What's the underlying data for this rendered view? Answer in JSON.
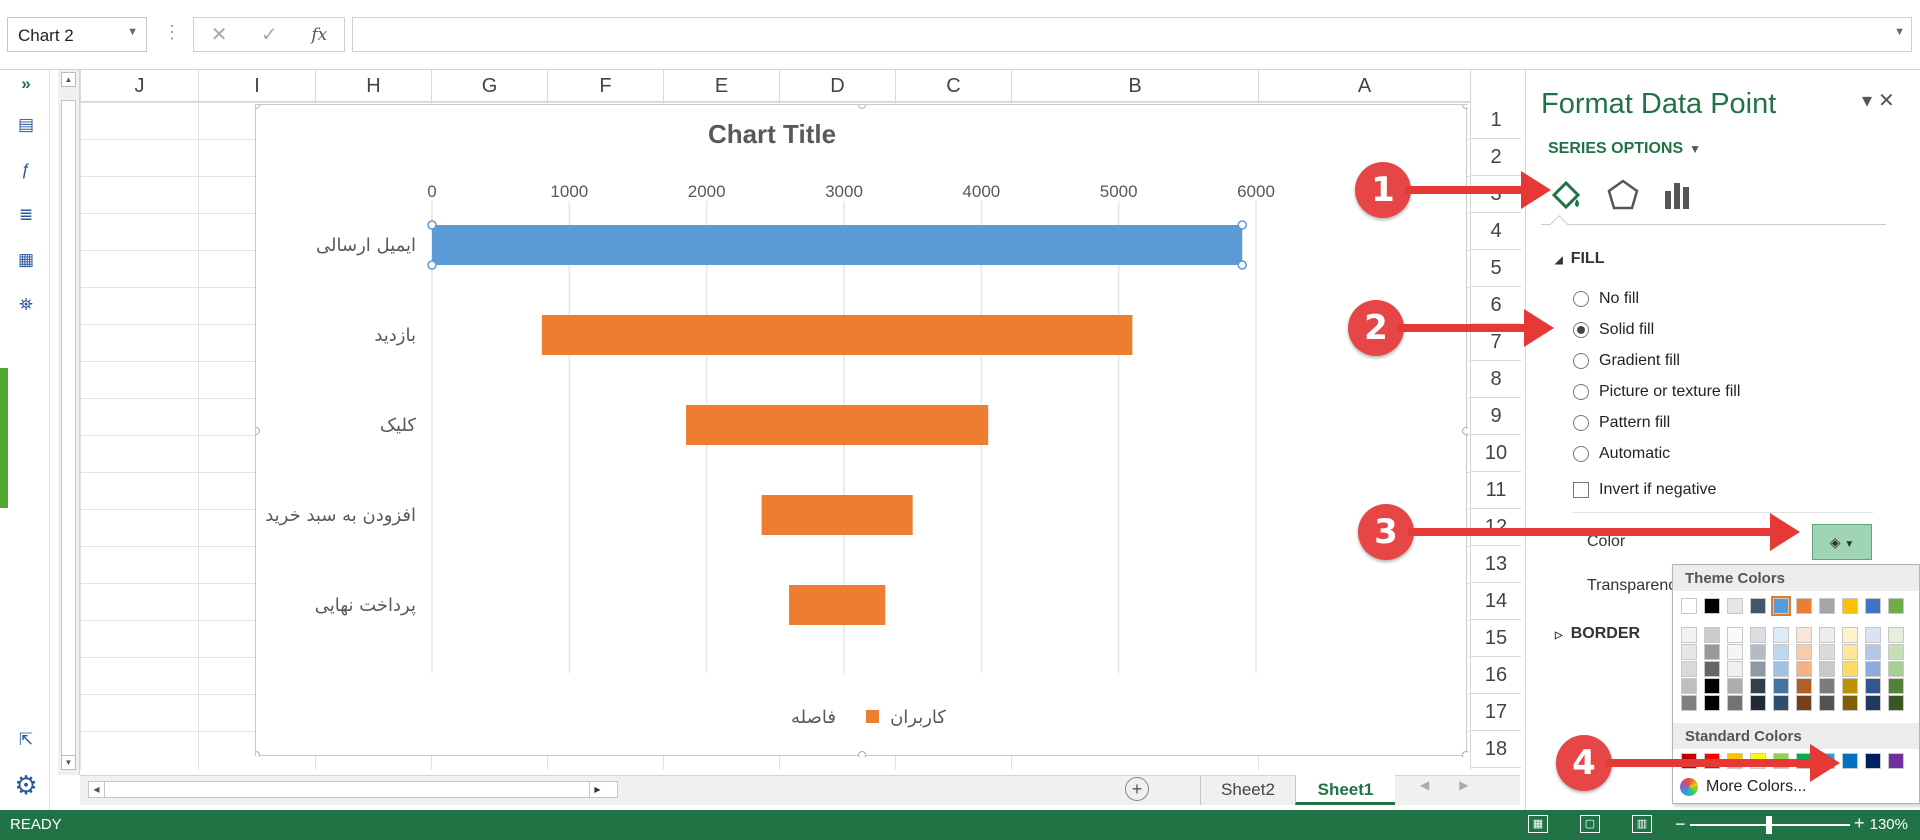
{
  "formula_bar": {
    "name_box": "Chart 2",
    "fx_label": "fx",
    "cancel": "✕",
    "enter": "✓",
    "formula_value": ""
  },
  "columns": [
    "J",
    "I",
    "H",
    "G",
    "F",
    "E",
    "D",
    "C",
    "B",
    "A"
  ],
  "rows": [
    "1",
    "2",
    "3",
    "4",
    "5",
    "6",
    "7",
    "8",
    "9",
    "10",
    "11",
    "12",
    "13",
    "14",
    "15",
    "16",
    "17",
    "18"
  ],
  "chart_data": {
    "type": "bar",
    "title": "Chart Title",
    "orientation": "horizontal-reversed",
    "xlim": [
      0,
      6000
    ],
    "ticks": [
      "0",
      "1000",
      "2000",
      "3000",
      "4000",
      "5000",
      "6000"
    ],
    "categories": [
      "ایمیل ارسالی",
      "بازدید",
      "کلیک",
      "افزودن به سبد خرید",
      "پرداخت نهایی"
    ],
    "series": [
      {
        "name": "فاصله",
        "values": [
          0,
          800,
          1850,
          2400,
          2600
        ],
        "color": "none"
      },
      {
        "name": "کاربران",
        "values": [
          5900,
          4300,
          2200,
          1100,
          700
        ],
        "color": "#ed7d31"
      }
    ],
    "selected_point_color": "#5b9bd5",
    "legend": [
      "کاربران",
      "فاصله"
    ],
    "legend_position": "bottom"
  },
  "sheets": {
    "tabs": [
      "Sheet2",
      "Sheet1"
    ],
    "active": "Sheet1",
    "add": "+"
  },
  "status": {
    "mode": "READY",
    "zoom": "130%"
  },
  "pane": {
    "title": "Format Data Point",
    "section": "SERIES OPTIONS",
    "fill_header": "FILL",
    "fill_options": [
      "No fill",
      "Solid fill",
      "Gradient fill",
      "Picture or texture fill",
      "Pattern fill",
      "Automatic"
    ],
    "selected_fill": "Solid fill",
    "invert": "Invert if negative",
    "color_label": "Color",
    "transparency_label": "Transparenc",
    "border_header": "BORDER"
  },
  "color_popup": {
    "theme_header": "Theme Colors",
    "standard_header": "Standard Colors",
    "more": "More Colors...",
    "theme_top": [
      "#ffffff",
      "#000000",
      "#e7e6e6",
      "#44546a",
      "#5b9bd5",
      "#ed7d31",
      "#a5a5a5",
      "#ffc000",
      "#4472c4",
      "#70ad47"
    ],
    "standard": [
      "#c00000",
      "#ff0000",
      "#ffc000",
      "#ffff00",
      "#92d050",
      "#00b050",
      "#00b0f0",
      "#0070c0",
      "#002060",
      "#7030a0"
    ]
  },
  "annotations": [
    "1",
    "2",
    "3",
    "4"
  ]
}
